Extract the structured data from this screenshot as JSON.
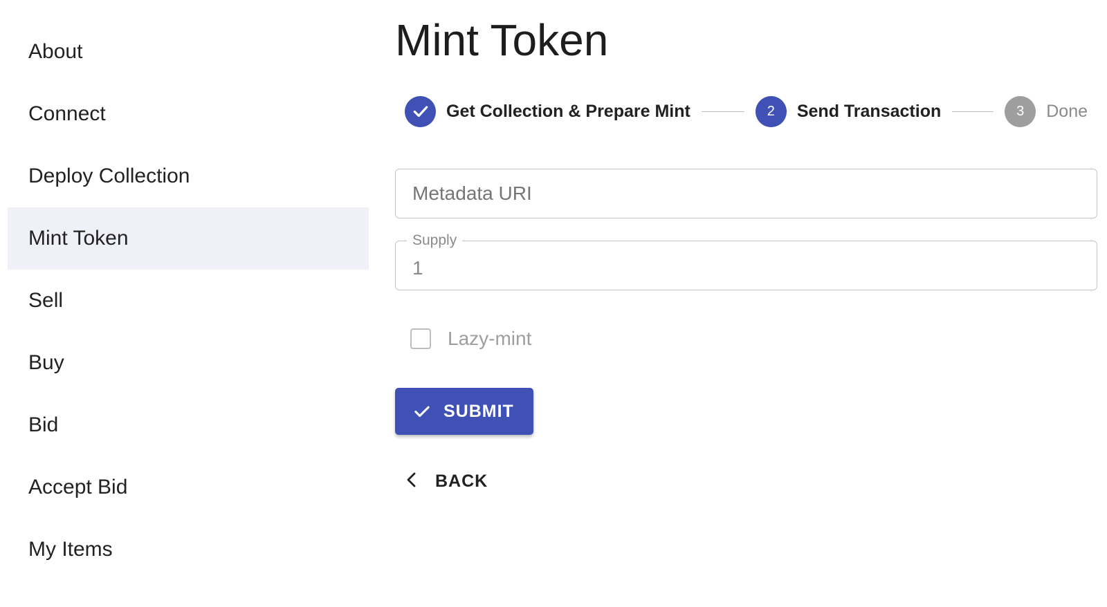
{
  "sidebar": {
    "items": [
      {
        "label": "About"
      },
      {
        "label": "Connect"
      },
      {
        "label": "Deploy Collection"
      },
      {
        "label": "Mint Token"
      },
      {
        "label": "Sell"
      },
      {
        "label": "Buy"
      },
      {
        "label": "Bid"
      },
      {
        "label": "Accept Bid"
      },
      {
        "label": "My Items"
      }
    ],
    "active": "Mint Token"
  },
  "main": {
    "title": "Mint Token",
    "stepper": {
      "steps": [
        {
          "label": "Get Collection & Prepare Mint",
          "state": "completed",
          "icon": "check-icon"
        },
        {
          "label": "Send Transaction",
          "state": "active",
          "number": "2"
        },
        {
          "label": "Done",
          "state": "pending",
          "number": "3"
        }
      ]
    },
    "form": {
      "metadata_uri": {
        "placeholder": "Metadata URI",
        "value": ""
      },
      "supply": {
        "label": "Supply",
        "value": "1"
      },
      "lazy_mint": {
        "label": "Lazy-mint",
        "checked": false
      }
    },
    "submit_label": "SUBMIT",
    "back_label": "BACK"
  },
  "colors": {
    "primary": "#3f51b5",
    "active_nav_bg": "#eff0f8",
    "pending_step": "#9e9e9e"
  }
}
